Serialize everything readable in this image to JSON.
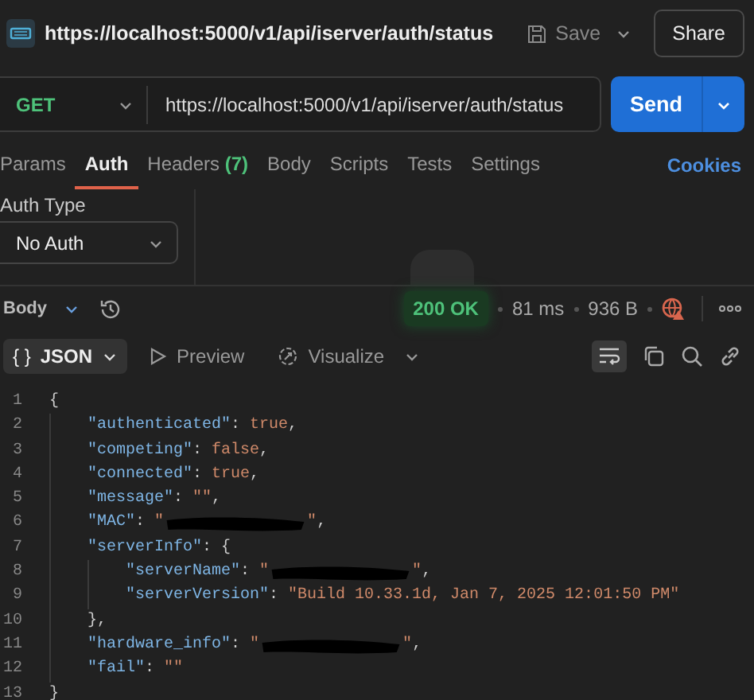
{
  "request_title": "https://localhost:5000/v1/api/iserver/auth/status",
  "header_buttons": {
    "save": "Save",
    "share": "Share"
  },
  "url_bar": {
    "method": "GET",
    "url": "https://localhost:5000/v1/api/iserver/auth/status",
    "send": "Send"
  },
  "tabs": [
    {
      "label": "Params",
      "selected": false
    },
    {
      "label": "Auth",
      "selected": true
    },
    {
      "label": "Headers",
      "count": "(7)",
      "selected": false
    },
    {
      "label": "Body",
      "selected": false
    },
    {
      "label": "Scripts",
      "selected": false
    },
    {
      "label": "Tests",
      "selected": false
    },
    {
      "label": "Settings",
      "selected": false
    }
  ],
  "cookies_link": "Cookies",
  "auth": {
    "label": "Auth Type",
    "value": "No Auth"
  },
  "response": {
    "section": "Body",
    "status": "200 OK",
    "time": "81 ms",
    "size": "936 B"
  },
  "view_tabs": [
    {
      "label": "JSON",
      "symbol": "{ }",
      "selected": true,
      "kind": "dropdown"
    },
    {
      "label": "Preview",
      "selected": false,
      "kind": "preview"
    },
    {
      "label": "Visualize",
      "selected": false,
      "kind": "visualize"
    }
  ],
  "wrap_lines": true,
  "code": [
    {
      "num": "1",
      "tokens": [
        {
          "kind": "punct",
          "text": "{"
        }
      ],
      "children": [
        {
          "num": "2",
          "tokens": [
            {
              "kind": "key",
              "text": "\"authenticated\""
            },
            {
              "kind": "punct",
              "text": ": "
            },
            {
              "kind": "bool",
              "text": "true"
            },
            {
              "kind": "punct",
              "text": ","
            }
          ]
        },
        {
          "num": "3",
          "tokens": [
            {
              "kind": "key",
              "text": "\"competing\""
            },
            {
              "kind": "punct",
              "text": ": "
            },
            {
              "kind": "bool",
              "text": "false"
            },
            {
              "kind": "punct",
              "text": ","
            }
          ]
        },
        {
          "num": "4",
          "tokens": [
            {
              "kind": "key",
              "text": "\"connected\""
            },
            {
              "kind": "punct",
              "text": ": "
            },
            {
              "kind": "bool",
              "text": "true"
            },
            {
              "kind": "punct",
              "text": ","
            }
          ]
        },
        {
          "num": "5",
          "tokens": [
            {
              "kind": "key",
              "text": "\"message\""
            },
            {
              "kind": "punct",
              "text": ": "
            },
            {
              "kind": "string",
              "text": "\"\""
            },
            {
              "kind": "punct",
              "text": ","
            }
          ]
        },
        {
          "num": "6",
          "tokens": [
            {
              "kind": "key",
              "text": "\"MAC\""
            },
            {
              "kind": "punct",
              "text": ": "
            },
            {
              "kind": "string",
              "text": "\""
            },
            {
              "kind": "redacted"
            },
            {
              "kind": "string",
              "text": "\""
            },
            {
              "kind": "punct",
              "text": ","
            }
          ]
        },
        {
          "num": "7",
          "tokens": [
            {
              "kind": "key",
              "text": "\"serverInfo\""
            },
            {
              "kind": "punct",
              "text": ": {"
            }
          ],
          "children": [
            {
              "num": "8",
              "tokens": [
                {
                  "kind": "key",
                  "text": "\"serverName\""
                },
                {
                  "kind": "punct",
                  "text": ": "
                },
                {
                  "kind": "string",
                  "text": "\""
                },
                {
                  "kind": "redacted"
                },
                {
                  "kind": "string",
                  "text": "\""
                },
                {
                  "kind": "punct",
                  "text": ","
                }
              ]
            },
            {
              "num": "9",
              "tokens": [
                {
                  "kind": "key",
                  "text": "\"serverVersion\""
                },
                {
                  "kind": "punct",
                  "text": ": "
                },
                {
                  "kind": "string",
                  "text": "\"Build 10.33.1d, Jan 7, 2025 12:01:50 PM\""
                }
              ]
            }
          ]
        },
        {
          "num": "10",
          "tokens": [
            {
              "kind": "punct",
              "text": "},"
            }
          ]
        },
        {
          "num": "11",
          "tokens": [
            {
              "kind": "key",
              "text": "\"hardware_info\""
            },
            {
              "kind": "punct",
              "text": ": "
            },
            {
              "kind": "string",
              "text": "\""
            },
            {
              "kind": "redacted"
            },
            {
              "kind": "string",
              "text": "\""
            },
            {
              "kind": "punct",
              "text": ","
            }
          ]
        },
        {
          "num": "12",
          "tokens": [
            {
              "kind": "key",
              "text": "\"fail\""
            },
            {
              "kind": "punct",
              "text": ": "
            },
            {
              "kind": "string",
              "text": "\"\""
            }
          ]
        }
      ]
    },
    {
      "num": "13",
      "tokens": [
        {
          "kind": "punct",
          "text": "}"
        }
      ]
    }
  ]
}
